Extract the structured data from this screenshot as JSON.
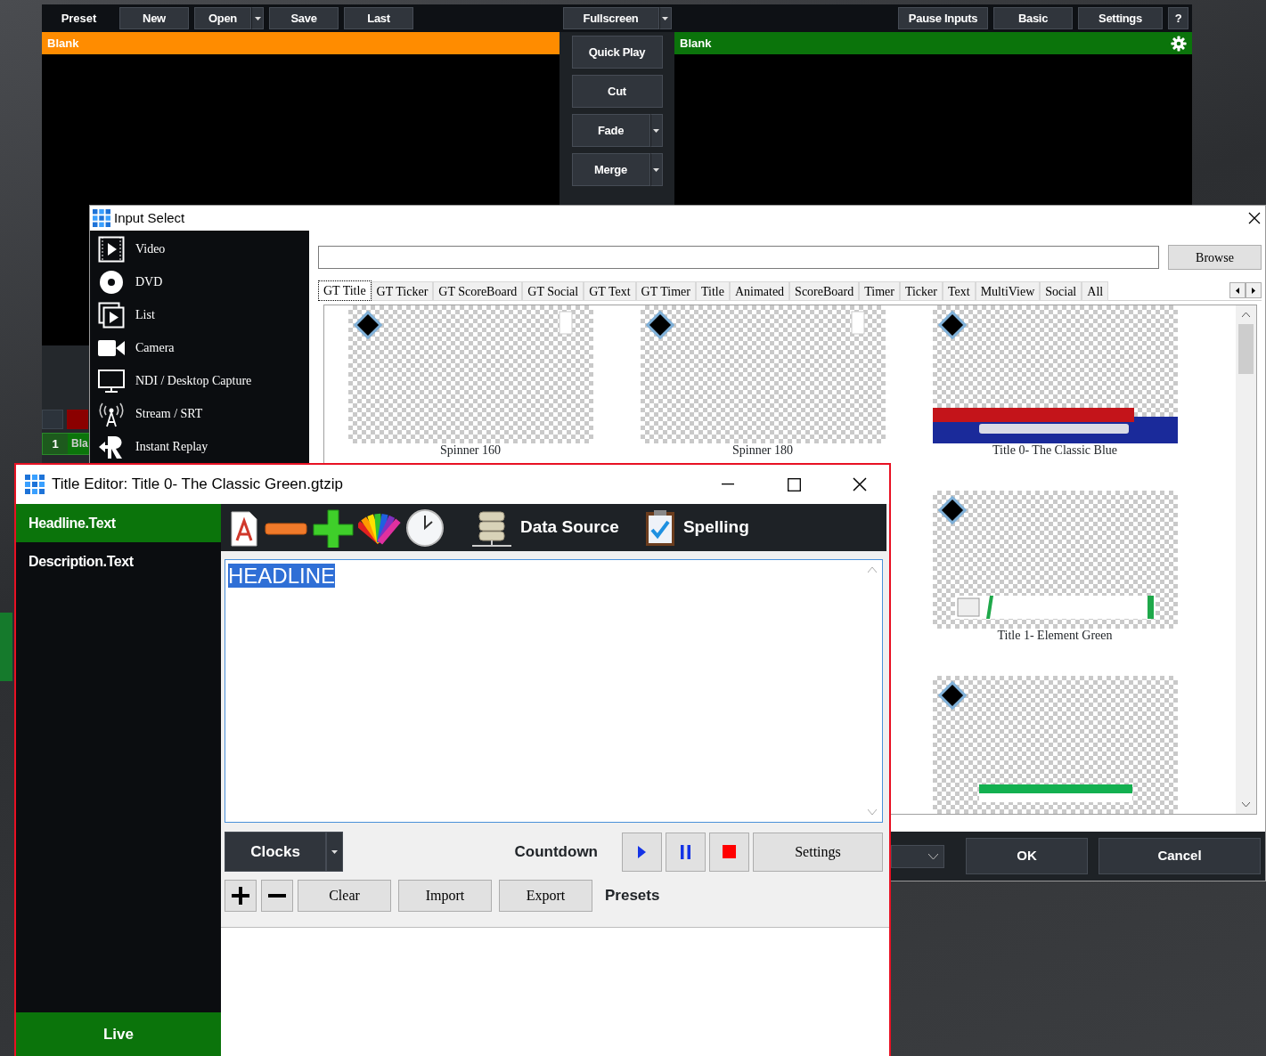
{
  "main_window": {
    "toolbar_left": [
      {
        "label": "Preset",
        "kind": "label"
      },
      {
        "label": "New",
        "kind": "button"
      },
      {
        "label": "Open",
        "kind": "split"
      },
      {
        "label": "Save",
        "kind": "button"
      },
      {
        "label": "Last",
        "kind": "button"
      }
    ],
    "toolbar_center": [
      {
        "label": "Fullscreen",
        "kind": "split"
      }
    ],
    "toolbar_right": [
      {
        "label": "Pause Inputs",
        "kind": "button"
      },
      {
        "label": "Basic",
        "kind": "button"
      },
      {
        "label": "Settings",
        "kind": "button"
      },
      {
        "label": "?",
        "kind": "small"
      }
    ],
    "preview": {
      "title": "Blank"
    },
    "output": {
      "title": "Blank"
    },
    "transitions": [
      {
        "label": "Quick Play",
        "kind": "button"
      },
      {
        "label": "Cut",
        "kind": "button"
      },
      {
        "label": "Fade",
        "kind": "split"
      },
      {
        "label": "Merge",
        "kind": "split"
      }
    ],
    "input": {
      "number": "1",
      "label": "Bla"
    }
  },
  "input_select": {
    "title": "Input Select",
    "categories": [
      {
        "label": "Video",
        "kind": "video"
      },
      {
        "label": "DVD",
        "kind": "dvd"
      },
      {
        "label": "List",
        "kind": "list"
      },
      {
        "label": "Camera",
        "kind": "camera"
      },
      {
        "label": "NDI / Desktop Capture",
        "kind": "ndi"
      },
      {
        "label": "Stream / SRT",
        "kind": "stream"
      },
      {
        "label": "Instant Replay",
        "kind": "replay"
      }
    ],
    "browse": "Browse",
    "tabs": [
      {
        "label": "GT Title",
        "selected": true
      },
      {
        "label": "GT Ticker",
        "selected": false
      },
      {
        "label": "GT ScoreBoard",
        "selected": false
      },
      {
        "label": "GT Social",
        "selected": false
      },
      {
        "label": "GT Text",
        "selected": false
      },
      {
        "label": "GT Timer",
        "selected": false
      },
      {
        "label": "Title",
        "selected": false
      },
      {
        "label": "Animated",
        "selected": false
      },
      {
        "label": "ScoreBoard",
        "selected": false
      },
      {
        "label": "Timer",
        "selected": false
      },
      {
        "label": "Ticker",
        "selected": false
      },
      {
        "label": "Text",
        "selected": false
      },
      {
        "label": "MultiView",
        "selected": false
      },
      {
        "label": "Social",
        "selected": false
      },
      {
        "label": "All",
        "selected": false
      }
    ],
    "items": [
      {
        "name": "Spinner 160",
        "kind": "spinner"
      },
      {
        "name": "Spinner 180",
        "kind": "spinner"
      },
      {
        "name": "Title 0- The Classic Blue",
        "kind": "classic-blue"
      },
      {
        "kind": "empty"
      },
      {
        "kind": "empty"
      },
      {
        "name": "Title 1- Element Green",
        "kind": "element-green"
      },
      {
        "kind": "empty"
      },
      {
        "kind": "empty"
      },
      {
        "kind": "green-bar"
      }
    ],
    "ok": "OK",
    "cancel": "Cancel"
  },
  "title_editor": {
    "title": "Title Editor: Title 0- The Classic Green.gtzip",
    "fields": [
      {
        "label": "Headline.Text",
        "selected": true
      },
      {
        "label": "Description.Text",
        "selected": false
      }
    ],
    "live": "Live",
    "data_source": "Data Source",
    "spelling": "Spelling",
    "editor": {
      "text": "HEADLINE",
      "selected": true
    },
    "clocks": "Clocks",
    "countdown": "Countdown",
    "settings": "Settings",
    "preset_buttons": [
      "Clear",
      "Import",
      "Export"
    ],
    "presets": "Presets"
  }
}
